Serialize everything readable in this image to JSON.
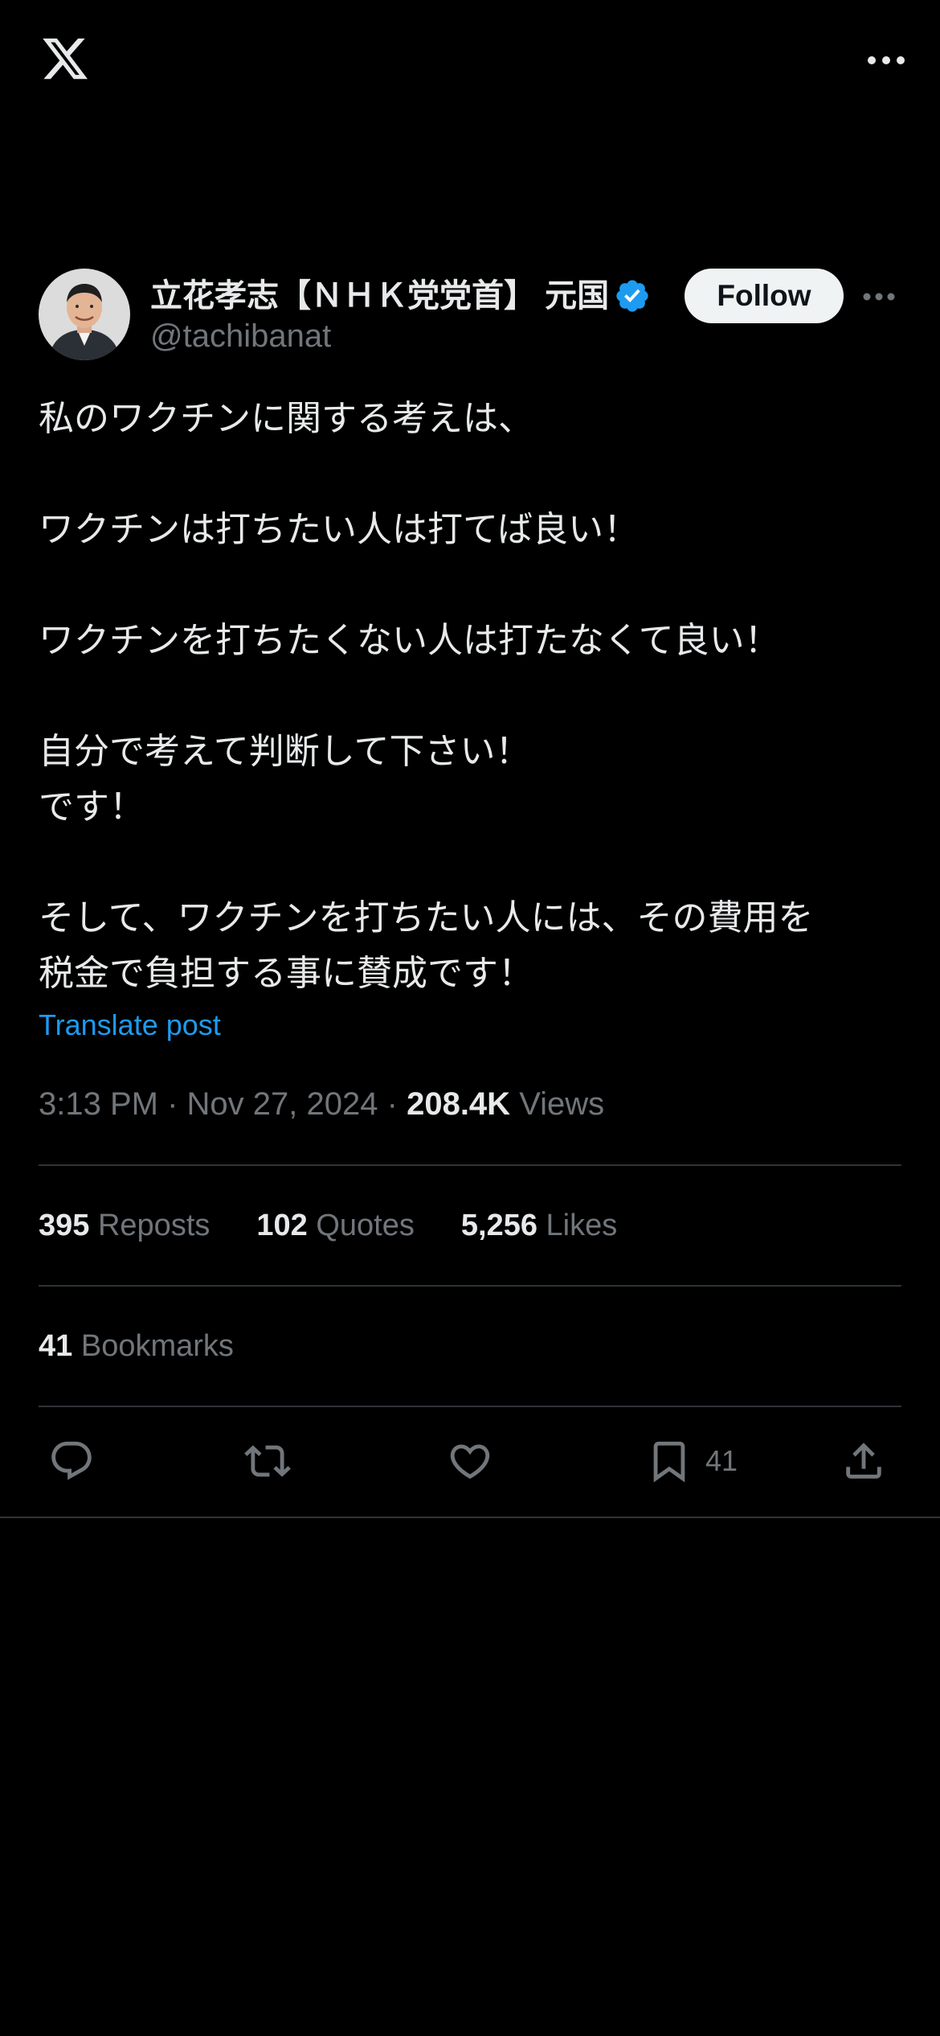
{
  "header": {
    "logo_icon": "x-logo-icon",
    "more_icon": "more-horizontal-icon"
  },
  "author": {
    "display_name": "立花孝志【ＮＨＫ党党首】 元国",
    "handle": "@tachibanat",
    "verified_color": "#1d9bf0",
    "follow_label": "Follow"
  },
  "tweet": {
    "lines": [
      "私のワクチンに関する考えは、",
      "",
      "ワクチンは打ちたい人は打てば良い！",
      "",
      "ワクチンを打ちたくない人は打たなくて良い！",
      "",
      "自分で考えて判断して下さい！",
      "です！",
      "",
      "そして、ワクチンを打ちたい人には、その費用を",
      "税金で負担する事に賛成です！"
    ],
    "translate_label": "Translate post"
  },
  "meta": {
    "time": "3:13 PM",
    "separator": "·",
    "date": "Nov 27, 2024",
    "views_count": "208.4K",
    "views_label": "Views"
  },
  "stats": {
    "reposts_count": "395",
    "reposts_label": "Reposts",
    "quotes_count": "102",
    "quotes_label": "Quotes",
    "likes_count": "5,256",
    "likes_label": "Likes",
    "bookmarks_count": "41",
    "bookmarks_label": "Bookmarks"
  },
  "actions": {
    "reply_icon": "reply-icon",
    "repost_icon": "repost-icon",
    "like_icon": "heart-icon",
    "bookmark_icon": "bookmark-icon",
    "bookmark_count": "41",
    "share_icon": "share-icon"
  },
  "colors": {
    "background": "#000000",
    "text_primary": "#e7e9ea",
    "text_secondary": "#71767b",
    "accent": "#1d9bf0",
    "divider": "#2f3336"
  }
}
